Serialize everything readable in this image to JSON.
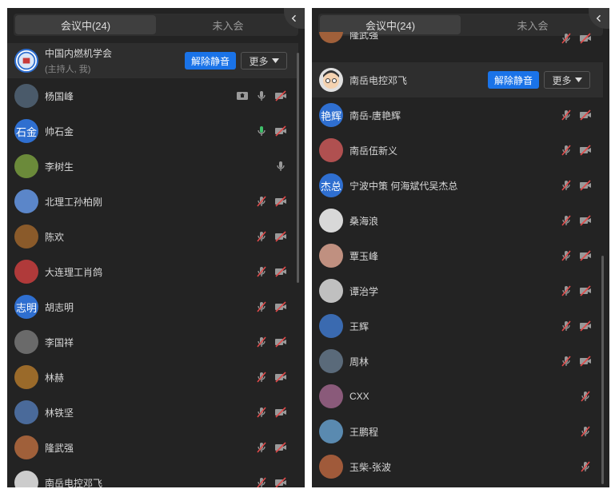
{
  "tabs": {
    "in_meeting": "会议中(24)",
    "not_joined": "未入会"
  },
  "buttons": {
    "unmute": "解除静音",
    "more": "更多"
  },
  "left": {
    "host": {
      "name": "中国内燃机学会",
      "role": "(主持人, 我)"
    },
    "rows": [
      {
        "name": "杨国峰",
        "avatar": "",
        "color": "#4a5a6a",
        "status": "share-mic-cam"
      },
      {
        "name": "帅石金",
        "avatar": "石金",
        "color": "#2f6fd0",
        "status": "mic-green-cam"
      },
      {
        "name": "李树生",
        "avatar": "",
        "color": "#6b8a3a",
        "status": "mic-only"
      },
      {
        "name": "北理工孙柏刚",
        "avatar": "",
        "color": "#5b86c9",
        "status": "muted"
      },
      {
        "name": "陈欢",
        "avatar": "",
        "color": "#8a5a2a",
        "status": "muted"
      },
      {
        "name": "大连理工肖鸽",
        "avatar": "",
        "color": "#b03a3a",
        "status": "muted"
      },
      {
        "name": "胡志明",
        "avatar": "志明",
        "color": "#2f6fd0",
        "status": "muted"
      },
      {
        "name": "李国祥",
        "avatar": "",
        "color": "#6a6a6a",
        "status": "muted"
      },
      {
        "name": "林赫",
        "avatar": "",
        "color": "#9a6a2a",
        "status": "muted"
      },
      {
        "name": "林铁坚",
        "avatar": "",
        "color": "#4a6a9a",
        "status": "muted"
      },
      {
        "name": "隆武强",
        "avatar": "",
        "color": "#a0603a",
        "status": "muted"
      },
      {
        "name": "南岳电控邓飞",
        "avatar": "",
        "color": "#cccccc",
        "status": "muted"
      }
    ]
  },
  "right": {
    "top_partial": {
      "name": "隆武强",
      "color": "#a0603a"
    },
    "host": {
      "name": "南岳电控邓飞",
      "color": "#e0e0e0"
    },
    "rows": [
      {
        "name": "南岳-唐艳辉",
        "avatar": "艳辉",
        "color": "#2f6fd0",
        "status": "muted"
      },
      {
        "name": "南岳伍新义",
        "avatar": "",
        "color": "#b05050",
        "status": "muted"
      },
      {
        "name": "宁波中策 何海斌代吴杰总",
        "avatar": "杰总",
        "color": "#2f6fd0",
        "status": "muted"
      },
      {
        "name": "桑海浪",
        "avatar": "",
        "color": "#d8d8d8",
        "status": "muted"
      },
      {
        "name": "覃玉峰",
        "avatar": "",
        "color": "#c09080",
        "status": "muted"
      },
      {
        "name": "谭治学",
        "avatar": "",
        "color": "#c0c0c0",
        "status": "muted"
      },
      {
        "name": "王辉",
        "avatar": "",
        "color": "#3a6ab0",
        "status": "muted"
      },
      {
        "name": "周林",
        "avatar": "",
        "color": "#5a6a7a",
        "status": "muted"
      },
      {
        "name": "CXX",
        "avatar": "",
        "color": "#8a5a7a",
        "status": "mic-muted-only"
      },
      {
        "name": "王鹏程",
        "avatar": "",
        "color": "#5a8ab0",
        "status": "mic-muted-only"
      },
      {
        "name": "玉柴-张波",
        "avatar": "",
        "color": "#a05a3a",
        "status": "mic-muted-only"
      }
    ]
  }
}
